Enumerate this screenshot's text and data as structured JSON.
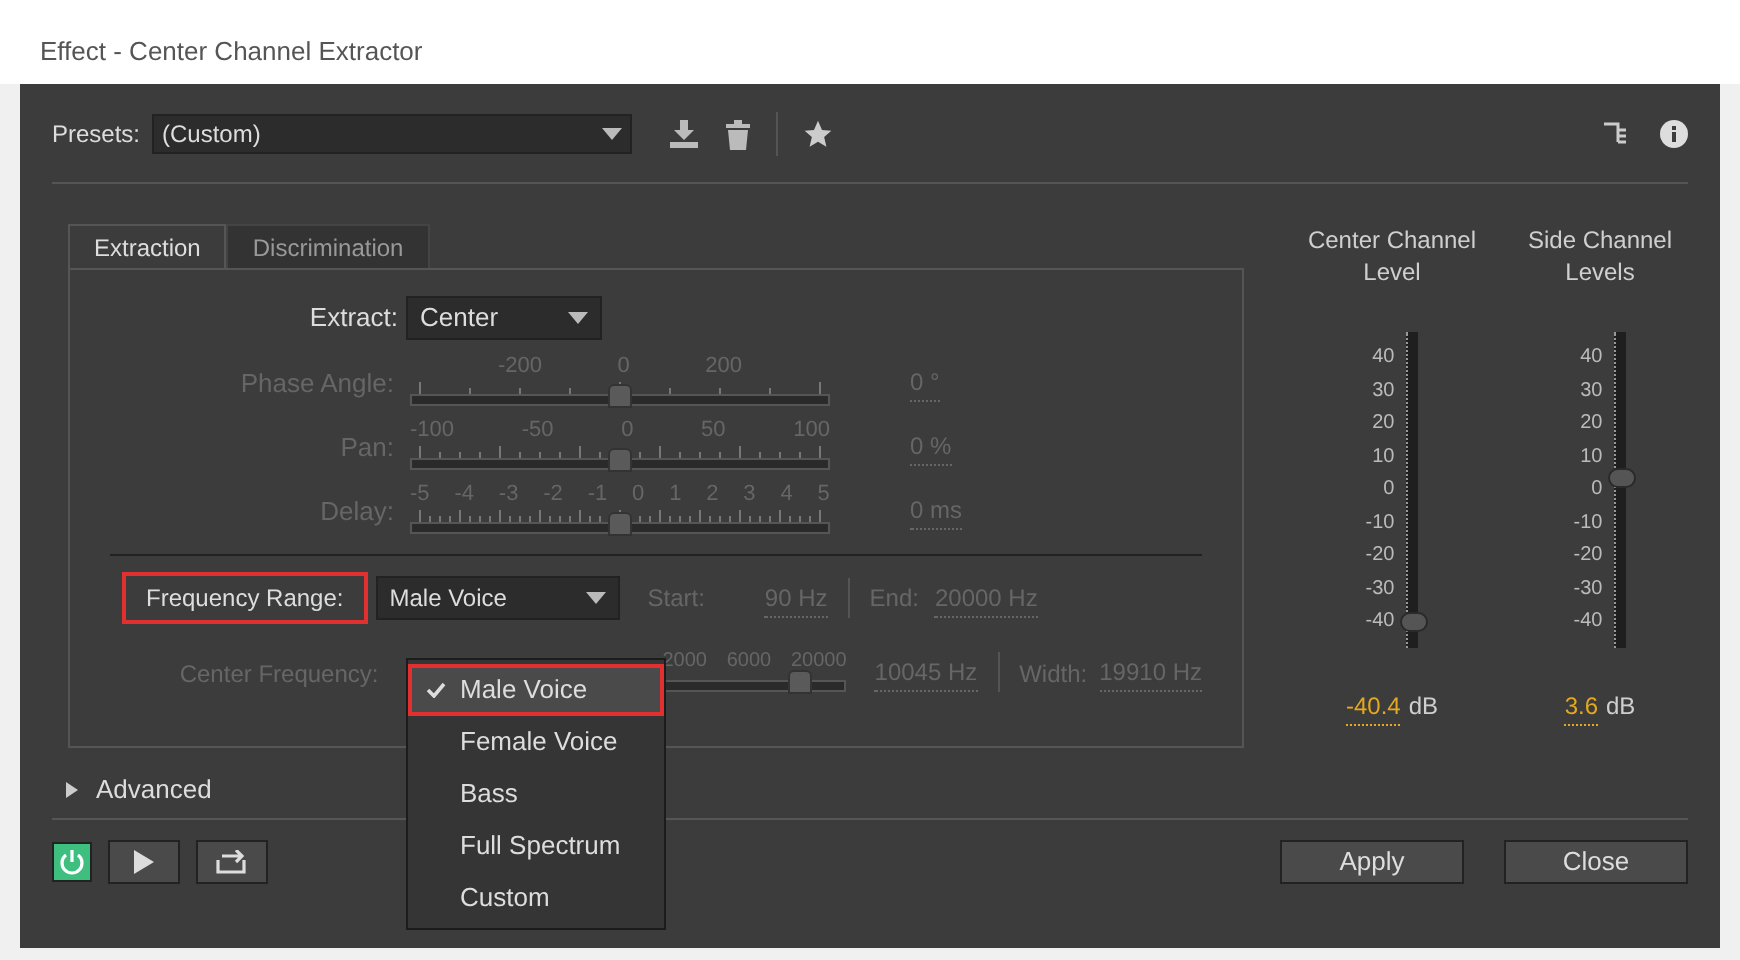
{
  "window": {
    "title": "Effect - Center Channel Extractor"
  },
  "presets": {
    "label": "Presets:",
    "value": "(Custom)"
  },
  "tabs": [
    {
      "label": "Extraction",
      "selected": true
    },
    {
      "label": "Discrimination",
      "selected": false
    }
  ],
  "extract": {
    "label": "Extract:",
    "value": "Center"
  },
  "sliders": [
    {
      "label": "Phase Angle:",
      "ticks": [
        "-200",
        "0",
        "200"
      ],
      "level": 0.5,
      "reading": "0 °",
      "disabled": true
    },
    {
      "label": "Pan:",
      "ticks": [
        "-100",
        "-50",
        "0",
        "50",
        "100"
      ],
      "level": 0.5,
      "reading": "0 %",
      "disabled": true
    },
    {
      "label": "Delay:",
      "ticks": [
        "-5",
        "-4",
        "-3",
        "-2",
        "-1",
        "0",
        "1",
        "2",
        "3",
        "4",
        "5"
      ],
      "level": 0.5,
      "reading": "0 ms",
      "disabled": true
    }
  ],
  "frequency_range": {
    "label": "Frequency Range:",
    "value": "Male Voice",
    "annotated": true
  },
  "start": {
    "label": "Start:",
    "value": "90 Hz",
    "disabled": true
  },
  "end": {
    "label": "End:",
    "value": "20000 Hz",
    "disabled": true
  },
  "center_frequency": {
    "label": "Center Frequency:",
    "ticks": [
      "2000",
      "6000",
      "20000"
    ],
    "level": 0.75,
    "reading": "10045 Hz",
    "disabled": true
  },
  "width": {
    "label": "Width:",
    "value": "19910 Hz",
    "disabled": true
  },
  "menu": [
    {
      "label": "Male Voice",
      "selected": true,
      "annotated": true
    },
    {
      "label": "Female Voice",
      "selected": false,
      "annotated": false
    },
    {
      "label": "Bass",
      "selected": false,
      "annotated": false
    },
    {
      "label": "Full Spectrum",
      "selected": false,
      "annotated": false
    },
    {
      "label": "Custom",
      "selected": false,
      "annotated": false
    }
  ],
  "advanced": {
    "label": "Advanced",
    "expanded": false
  },
  "meters": [
    {
      "title": "Center Channel Level",
      "ticks": [
        "40",
        "30",
        "20",
        "10",
        "0",
        "-10",
        "-20",
        "-30",
        "-40"
      ],
      "level": 0.08,
      "value": "-40.4",
      "unit": "dB"
    },
    {
      "title": "Side Channel Levels",
      "ticks": [
        "40",
        "30",
        "20",
        "10",
        "0",
        "-10",
        "-20",
        "-30",
        "-40"
      ],
      "level": 0.54,
      "value": "3.6",
      "unit": "dB"
    }
  ],
  "power": {
    "on": true
  },
  "buttons": [
    "Apply",
    "Close"
  ]
}
